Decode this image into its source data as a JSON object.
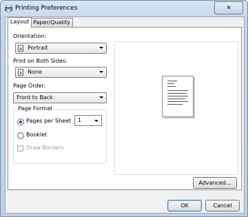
{
  "window": {
    "title": "Printing Preferences",
    "close_symbol": "✕"
  },
  "tabs": [
    {
      "label": "Layout",
      "active": true
    },
    {
      "label": "Paper/Quality",
      "active": false
    }
  ],
  "layout": {
    "orientation": {
      "label": "Orientation:",
      "value": "Portrait",
      "icon": "portrait-page-icon"
    },
    "both_sides": {
      "label": "Print on Both Sides:",
      "value": "None",
      "icon": "page-icon"
    },
    "page_order": {
      "label": "Page Order:",
      "value": "Front to Back"
    },
    "page_format": {
      "title": "Page Format",
      "pages_per_sheet_label": "Pages per Sheet",
      "pages_per_sheet_value": "1",
      "booklet_label": "Booklet",
      "draw_borders_label": "Draw Borders",
      "selected": "pages-per-sheet"
    }
  },
  "buttons": {
    "advanced": "Advanced...",
    "ok": "OK",
    "cancel": "Cancel"
  }
}
